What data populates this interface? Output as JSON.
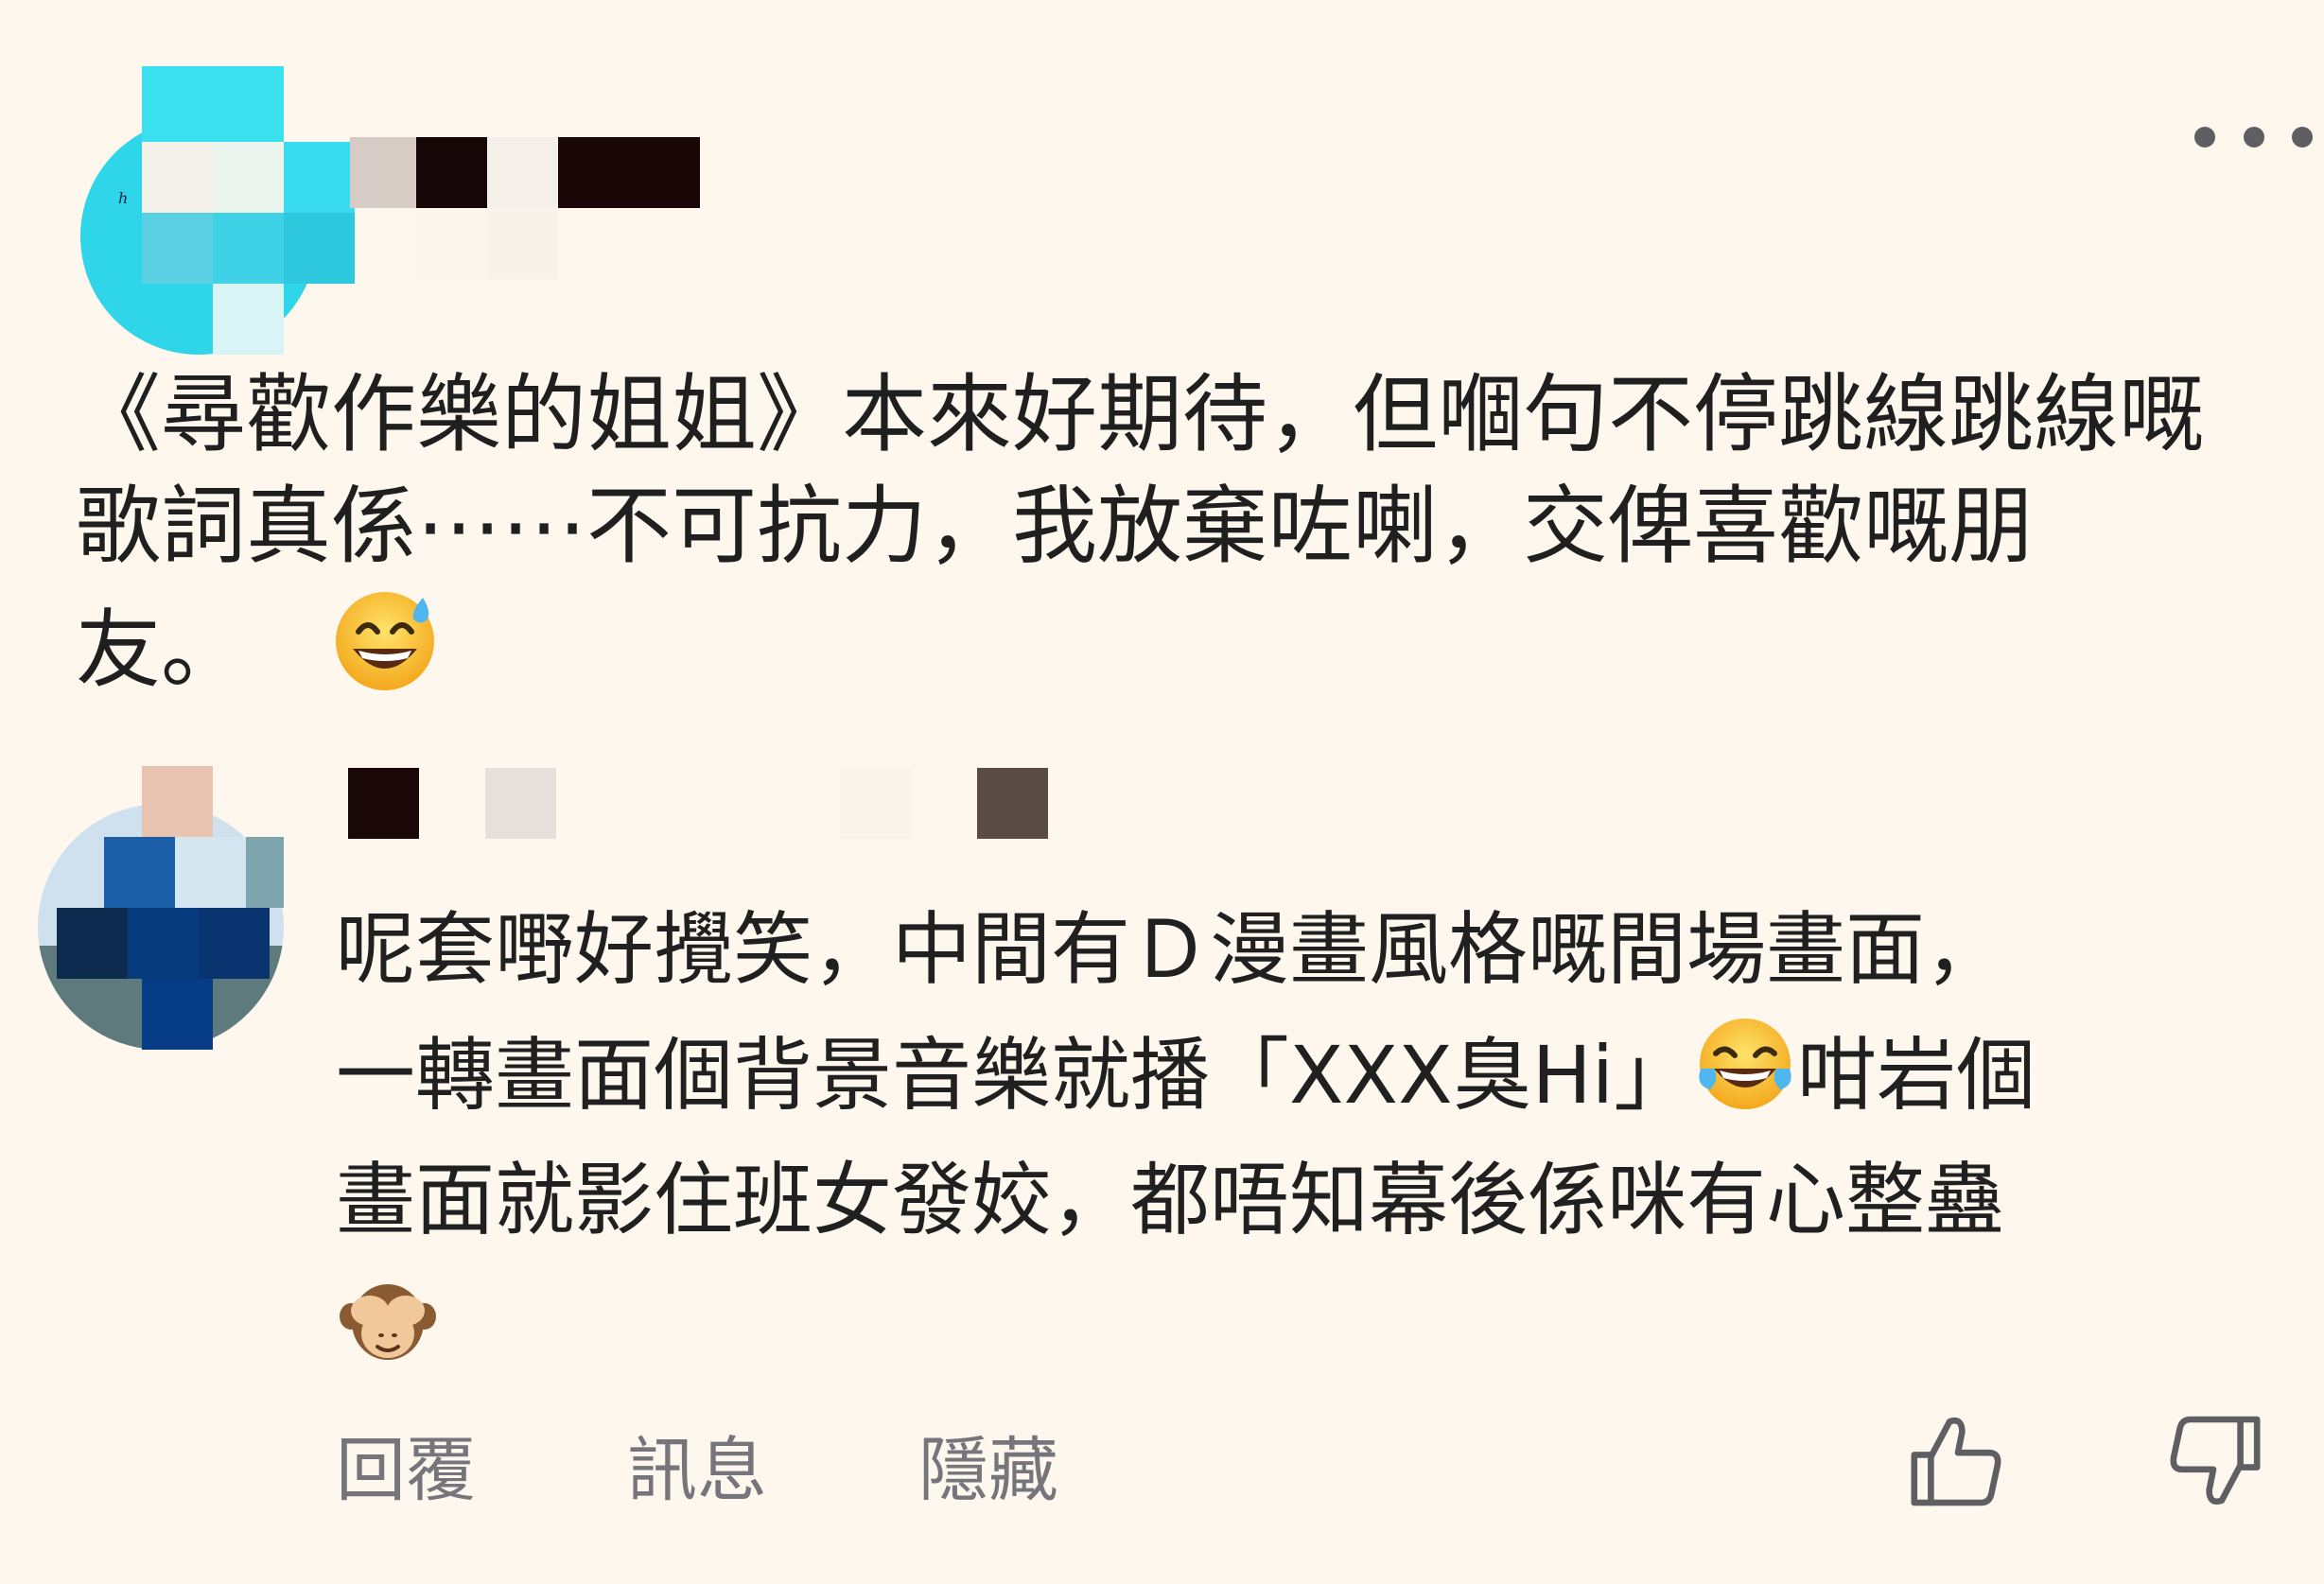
{
  "post": {
    "text_line1": "《尋歡作樂的姐姐》本來好期待，但嗰句不停跳線跳線嘅",
    "text_line2": "歌詞真係⋯⋯不可抗力，我放棄咗喇，交俾喜歡嘅朋",
    "text_line3": "友。",
    "emoji": "sweat-smile-emoji"
  },
  "reply": {
    "text_line1": "呢套嘢好攪笑，中間有Ｄ漫畫風格嘅間場畫面，",
    "text_line2a": "一轉畫面個背景音樂就播「XXX臭Hi」",
    "text_line2b": "咁岩個",
    "text_line3": "畫面就影住班女發姣，都唔知幕後係咪有心整蠱",
    "emoji_1": "joy-emoji",
    "emoji_2": "see-no-evil-monkey-emoji"
  },
  "actions": {
    "reply_label": "回覆",
    "message_label": "訊息",
    "hide_label": "隱藏"
  },
  "icons": {
    "more": "more-dots-icon",
    "like": "thumbs-up-icon",
    "dislike": "thumbs-down-icon"
  },
  "colors": {
    "background": "#fdf7ee",
    "text": "#1f1f1f",
    "muted": "#76757b",
    "avatar_accent": "#2fd6ea"
  }
}
